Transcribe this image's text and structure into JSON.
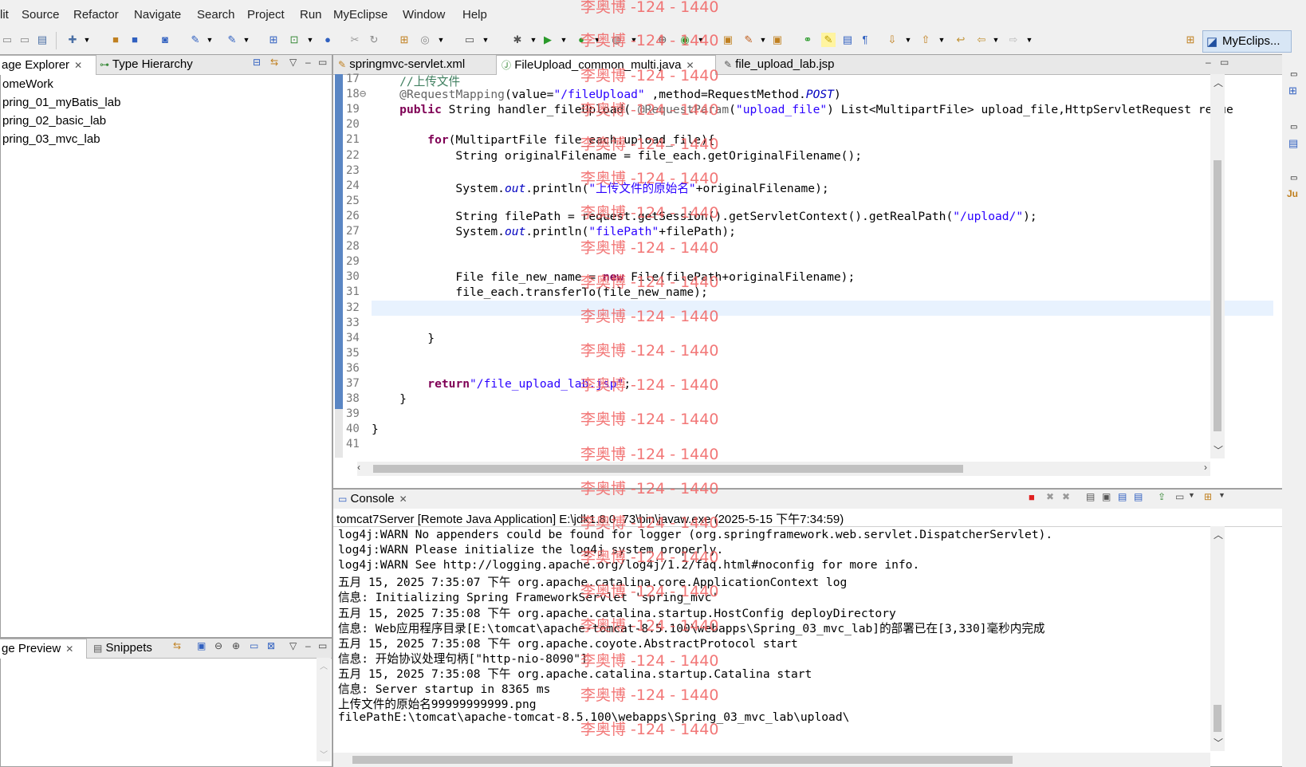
{
  "menu": [
    "lit",
    "Source",
    "Refactor",
    "Navigate",
    "Search",
    "Project",
    "Run",
    "MyEclipse",
    "Window",
    "Help"
  ],
  "perspective": "MyEclips...",
  "left_panel": {
    "tabs": [
      "age Explorer",
      "Type Hierarchy"
    ],
    "items": [
      "omeWork",
      "pring_01_myBatis_lab",
      "pring_02_basic_lab",
      "pring_03_mvc_lab"
    ]
  },
  "bottom_left_panel": {
    "tabs": [
      "ge Preview",
      "Snippets"
    ]
  },
  "editor": {
    "tabs": [
      "springmvc-servlet.xml",
      "FileUpload_common_multi.java",
      "file_upload_lab.jsp"
    ],
    "line_numbers": [
      "17",
      "18⊖",
      "19",
      "20",
      "21",
      "22",
      "23",
      "24",
      "25",
      "26",
      "27",
      "28",
      "29",
      "30",
      "31",
      "32",
      "33",
      "34",
      "35",
      "36",
      "37",
      "38",
      "39",
      "40",
      "41"
    ],
    "lines": [
      "    //上传文件",
      "    @RequestMapping(value=\"/fileUpload\" ,method=RequestMethod.POST)",
      "    public String handler_fileUpload( @RequestParam(\"upload_file\") List<MultipartFile> upload_file,HttpServletRequest reque",
      "",
      "        for(MultipartFile file_each:upload_file){",
      "            String originalFilename = file_each.getOriginalFilename();",
      "",
      "            System.out.println(\"上传文件的原始名\"+originalFilename);",
      "",
      "            String filePath = request.getSession().getServletContext().getRealPath(\"/upload/\");",
      "            System.out.println(\"filePath\"+filePath);",
      "",
      "",
      "            File file_new_name = new File(filePath+originalFilename);",
      "            file_each.transferTo(file_new_name);",
      "",
      "",
      "        }",
      "",
      "",
      "        return\"/file_upload_lab.jsp\";",
      "    }",
      "",
      "}",
      ""
    ]
  },
  "console": {
    "tab": "Console",
    "header": "tomcat7Server [Remote Java Application] E:\\jdk1.8.0_73\\bin\\javaw.exe (2025-5-15 下午7:34:59)",
    "lines": [
      "log4j:WARN No appenders could be found for logger (org.springframework.web.servlet.DispatcherServlet).",
      "log4j:WARN Please initialize the log4j system properly.",
      "log4j:WARN See http://logging.apache.org/log4j/1.2/faq.html#noconfig for more info.",
      "五月 15, 2025 7:35:07 下午 org.apache.catalina.core.ApplicationContext log",
      "信息: Initializing Spring FrameworkServlet 'spring_mvc'",
      "五月 15, 2025 7:35:08 下午 org.apache.catalina.startup.HostConfig deployDirectory",
      "信息: Web应用程序目录[E:\\tomcat\\apache-tomcat-8.5.100\\webapps\\Spring_03_mvc_lab]的部署已在[3,330]毫秒内完成",
      "五月 15, 2025 7:35:08 下午 org.apache.coyote.AbstractProtocol start",
      "信息: 开始协议处理句柄[\"http-nio-8090\"]",
      "五月 15, 2025 7:35:08 下午 org.apache.catalina.startup.Catalina start",
      "信息: Server startup in 8365 ms",
      "上传文件的原始名99999999999.png",
      "filePathE:\\tomcat\\apache-tomcat-8.5.100\\webapps\\Spring_03_mvc_lab\\upload\\"
    ]
  },
  "watermark": "李奥博 -124 - 1440"
}
